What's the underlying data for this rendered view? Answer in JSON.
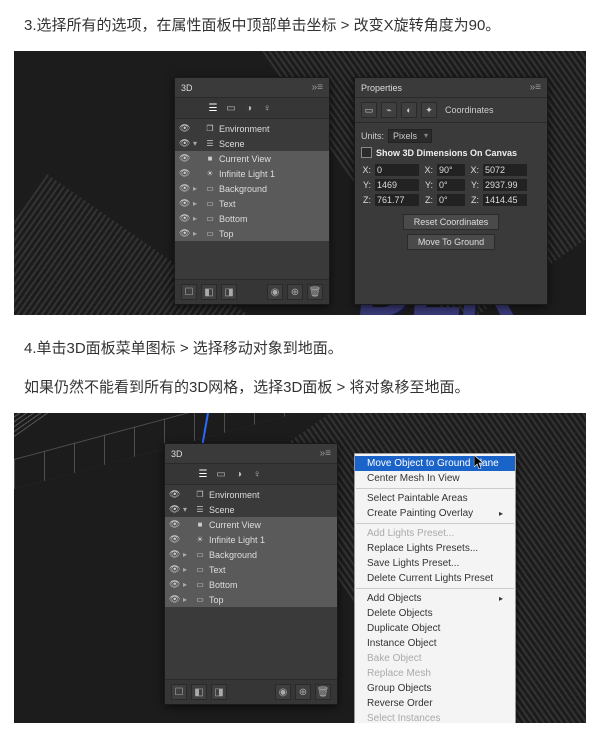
{
  "steps": {
    "s3": "3.选择所有的选项，在属性面板中顶部单击坐标 > 改变X旋转角度为90。",
    "s4a": "4.单击3D面板菜单图标 > 选择移动对象到地面。",
    "s4b": "如果仍然不能看到所有的3D网格，选择3D面板 > 将对象移至地面。"
  },
  "panels": {
    "threeD": {
      "title": "3D",
      "items": [
        {
          "icon": "❐",
          "label": "Environment",
          "sel": false
        },
        {
          "icon": "❐",
          "label": "Scene",
          "sel": false
        },
        {
          "icon": "■",
          "label": "Current View",
          "sel": true
        },
        {
          "icon": "☀",
          "label": "Infinite Light 1",
          "sel": true
        },
        {
          "icon": "▭",
          "label": "Background",
          "sel": true
        },
        {
          "icon": "▭",
          "label": "Text",
          "sel": true
        },
        {
          "icon": "▭",
          "label": "Bottom",
          "sel": true
        },
        {
          "icon": "▭",
          "label": "Top",
          "sel": true
        }
      ]
    },
    "props": {
      "title": "Properties",
      "modeLabel": "Coordinates",
      "unitsLabel": "Units:",
      "unitsValue": "Pixels",
      "showDims": "Show 3D Dimensions On Canvas",
      "coords": {
        "X": "0",
        "Xr": "90°",
        "Xs": "5072",
        "Y": "1469",
        "Yr": "0°",
        "Ys": "2937.99",
        "Z": "761.77",
        "Zr": "0°",
        "Zs": "1414.45"
      },
      "reset": "Reset Coordinates",
      "ground": "Move To Ground"
    }
  },
  "contextMenu": [
    {
      "label": "Move Object to Ground Plane",
      "type": "hi"
    },
    {
      "label": "Center Mesh In View",
      "type": "n"
    },
    {
      "type": "sep"
    },
    {
      "label": "Select Paintable Areas",
      "type": "n"
    },
    {
      "label": "Create Painting Overlay",
      "type": "sub"
    },
    {
      "type": "sep"
    },
    {
      "label": "Add Lights Preset...",
      "type": "dis"
    },
    {
      "label": "Replace Lights Presets...",
      "type": "n"
    },
    {
      "label": "Save Lights Preset...",
      "type": "n"
    },
    {
      "label": "Delete Current Lights Preset",
      "type": "n"
    },
    {
      "type": "sep"
    },
    {
      "label": "Add Objects",
      "type": "sub"
    },
    {
      "label": "Delete Objects",
      "type": "n"
    },
    {
      "label": "Duplicate Object",
      "type": "n"
    },
    {
      "label": "Instance Object",
      "type": "n"
    },
    {
      "label": "Bake Object",
      "type": "dis"
    },
    {
      "label": "Replace Mesh",
      "type": "dis"
    },
    {
      "label": "Group Objects",
      "type": "n"
    },
    {
      "label": "Reverse Order",
      "type": "n"
    },
    {
      "label": "Select Instances",
      "type": "dis"
    }
  ],
  "decoText": "DER"
}
